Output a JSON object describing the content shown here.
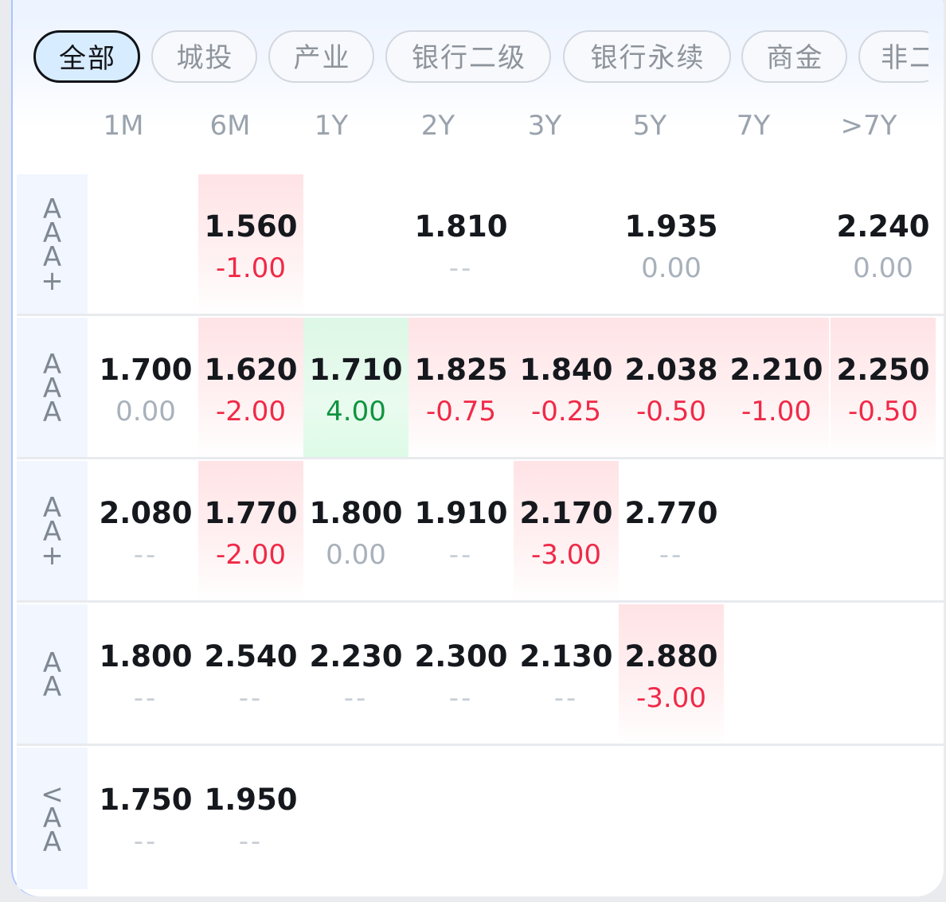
{
  "filters": [
    {
      "label": "全部",
      "active": true
    },
    {
      "label": "城投",
      "active": false
    },
    {
      "label": "产业",
      "active": false
    },
    {
      "label": "银行二级",
      "active": false
    },
    {
      "label": "银行永续",
      "active": false
    },
    {
      "label": "商金",
      "active": false
    },
    {
      "label": "非二",
      "active": false
    }
  ],
  "tenors": [
    "1M",
    "6M",
    "1Y",
    "2Y",
    "3Y",
    "5Y",
    "7Y",
    ">7Y"
  ],
  "rows": [
    {
      "rating": [
        "A",
        "A",
        "A",
        "+"
      ],
      "cells": [
        null,
        {
          "yield": "1.560",
          "change": "-1.00",
          "trend": "neg"
        },
        null,
        {
          "yield": "1.810",
          "change": "--",
          "trend": "none"
        },
        null,
        {
          "yield": "1.935",
          "change": "0.00",
          "trend": "flat"
        },
        null,
        {
          "yield": "2.240",
          "change": "0.00",
          "trend": "flat"
        }
      ]
    },
    {
      "rating": [
        "A",
        "A",
        "A"
      ],
      "cells": [
        {
          "yield": "1.700",
          "change": "0.00",
          "trend": "flat"
        },
        {
          "yield": "1.620",
          "change": "-2.00",
          "trend": "neg"
        },
        {
          "yield": "1.710",
          "change": "4.00",
          "trend": "pos"
        },
        {
          "yield": "1.825",
          "change": "-0.75",
          "trend": "neg"
        },
        {
          "yield": "1.840",
          "change": "-0.25",
          "trend": "neg"
        },
        {
          "yield": "2.038",
          "change": "-0.50",
          "trend": "neg"
        },
        {
          "yield": "2.210",
          "change": "-1.00",
          "trend": "neg"
        },
        {
          "yield": "2.250",
          "change": "-0.50",
          "trend": "neg"
        }
      ]
    },
    {
      "rating": [
        "A",
        "A",
        "+"
      ],
      "cells": [
        {
          "yield": "2.080",
          "change": "--",
          "trend": "none"
        },
        {
          "yield": "1.770",
          "change": "-2.00",
          "trend": "neg"
        },
        {
          "yield": "1.800",
          "change": "0.00",
          "trend": "flat"
        },
        {
          "yield": "1.910",
          "change": "--",
          "trend": "none"
        },
        {
          "yield": "2.170",
          "change": "-3.00",
          "trend": "neg"
        },
        {
          "yield": "2.770",
          "change": "--",
          "trend": "none"
        },
        null,
        null
      ]
    },
    {
      "rating": [
        "A",
        "A"
      ],
      "cells": [
        {
          "yield": "1.800",
          "change": "--",
          "trend": "none"
        },
        {
          "yield": "2.540",
          "change": "--",
          "trend": "none"
        },
        {
          "yield": "2.230",
          "change": "--",
          "trend": "none"
        },
        {
          "yield": "2.300",
          "change": "--",
          "trend": "none"
        },
        {
          "yield": "2.130",
          "change": "--",
          "trend": "none"
        },
        {
          "yield": "2.880",
          "change": "-3.00",
          "trend": "neg"
        },
        null,
        null
      ]
    },
    {
      "rating": [
        "<",
        "A",
        "A"
      ],
      "cells": [
        {
          "yield": "1.750",
          "change": "--",
          "trend": "none"
        },
        {
          "yield": "1.950",
          "change": "--",
          "trend": "none"
        },
        null,
        null,
        null,
        null,
        null,
        null
      ]
    }
  ],
  "colors": {
    "negative": "#f02a48",
    "positive": "#10943f",
    "flat": "#a8b1bb",
    "accent": "#d8ecff"
  }
}
